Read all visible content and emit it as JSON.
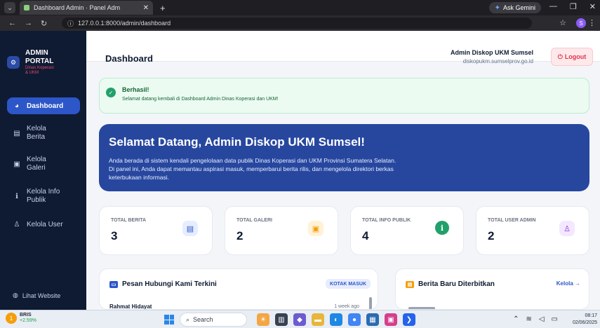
{
  "browser": {
    "tab_title": "Dashboard Admin · Panel Adm",
    "new_tab": "+",
    "gemini_label": "Ask Gemini",
    "url": "127.0.0.1:8000/admin/dashboard",
    "profile_initial": "S"
  },
  "sidebar": {
    "brand_line1": "ADMIN",
    "brand_line2": "PORTAL",
    "brand_sub1": "Dinas Koperasi",
    "brand_sub2": "& UKM",
    "items": [
      {
        "label": "Dashboard",
        "icon": "gauge-icon"
      },
      {
        "label_l1": "Kelola",
        "label_l2": "Berita",
        "icon": "newspaper-icon"
      },
      {
        "label_l1": "Kelola",
        "label_l2": "Galeri",
        "icon": "image-icon"
      },
      {
        "label_l1": "Kelola Info",
        "label_l2": "Publik",
        "icon": "info-icon"
      },
      {
        "label": "Kelola User",
        "icon": "user-icon"
      }
    ],
    "footer_link": "Lihat Website"
  },
  "header": {
    "title": "Dashboard",
    "admin_name": "Admin Diskop UKM Sumsel",
    "admin_email": "diskopukm.sumselprov.go.id",
    "logout_label": "Logout"
  },
  "alert": {
    "title": "Berhasil!",
    "message": "Selamat datang kembali di Dashboard Admin Dinas Koperasi dan UKM!"
  },
  "hero": {
    "title": "Selamat Datang, Admin Diskop UKM Sumsel!",
    "line1": "Anda berada di sistem kendali pengelolaan data publik Dinas Koperasi dan UKM Provinsi Sumatera Selatan.",
    "line2": "Di panel ini, Anda dapat memantau aspirasi masuk, memperbarui berita rilis, dan mengelola direktori berkas",
    "line3": "keterbukaan informasi."
  },
  "stats": [
    {
      "label": "TOTAL BERITA",
      "value": "3",
      "icon": "newspaper-icon",
      "color": "#2d56c8",
      "bg": "#e6edff"
    },
    {
      "label": "TOTAL GALERI",
      "value": "2",
      "icon": "image-icon",
      "color": "#f59e0b",
      "bg": "#fff2d6"
    },
    {
      "label": "TOTAL INFO PUBLIK",
      "value": "4",
      "icon": "info-icon",
      "color": "#ffffff",
      "bg": "#22a06b"
    },
    {
      "label": "TOTAL USER ADMIN",
      "value": "2",
      "icon": "user-icon",
      "color": "#9333ea",
      "bg": "#f3e8ff"
    }
  ],
  "panels": {
    "messages": {
      "title": "Pesan Hubungi Kami Terkini",
      "badge": "KOTAK MASUK",
      "first_name": "Rahmat Hidayat",
      "first_time": "1 week ago"
    },
    "news": {
      "title": "Berita Baru Diterbitkan",
      "link": "Kelola →"
    }
  },
  "taskbar": {
    "ticker_name": "BRIS",
    "ticker_change": "+2.59%",
    "search_placeholder": "Search",
    "time": "08:17",
    "date": "02/06/2025"
  }
}
